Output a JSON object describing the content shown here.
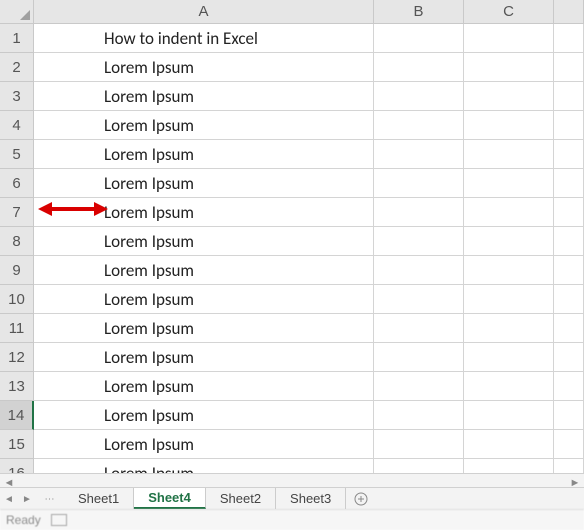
{
  "columns": {
    "A": "A",
    "B": "B",
    "C": "C"
  },
  "rows": [
    {
      "num": "1",
      "A": "How to indent in Excel"
    },
    {
      "num": "2",
      "A": "Lorem Ipsum"
    },
    {
      "num": "3",
      "A": "Lorem Ipsum"
    },
    {
      "num": "4",
      "A": "Lorem Ipsum"
    },
    {
      "num": "5",
      "A": "Lorem Ipsum"
    },
    {
      "num": "6",
      "A": "Lorem Ipsum"
    },
    {
      "num": "7",
      "A": "Lorem Ipsum"
    },
    {
      "num": "8",
      "A": "Lorem Ipsum"
    },
    {
      "num": "9",
      "A": "Lorem Ipsum"
    },
    {
      "num": "10",
      "A": "Lorem Ipsum"
    },
    {
      "num": "11",
      "A": "Lorem Ipsum"
    },
    {
      "num": "12",
      "A": "Lorem Ipsum"
    },
    {
      "num": "13",
      "A": "Lorem Ipsum"
    },
    {
      "num": "14",
      "A": "Lorem Ipsum"
    },
    {
      "num": "15",
      "A": "Lorem Ipsum"
    },
    {
      "num": "16",
      "A": "Lorem Ipsum"
    }
  ],
  "selected_row": "14",
  "tabs": {
    "items": [
      "Sheet1",
      "Sheet4",
      "Sheet2",
      "Sheet3"
    ],
    "active": "Sheet4"
  },
  "status": {
    "text": "Ready"
  },
  "annotation": {
    "type": "double-arrow",
    "color": "#d90000"
  }
}
